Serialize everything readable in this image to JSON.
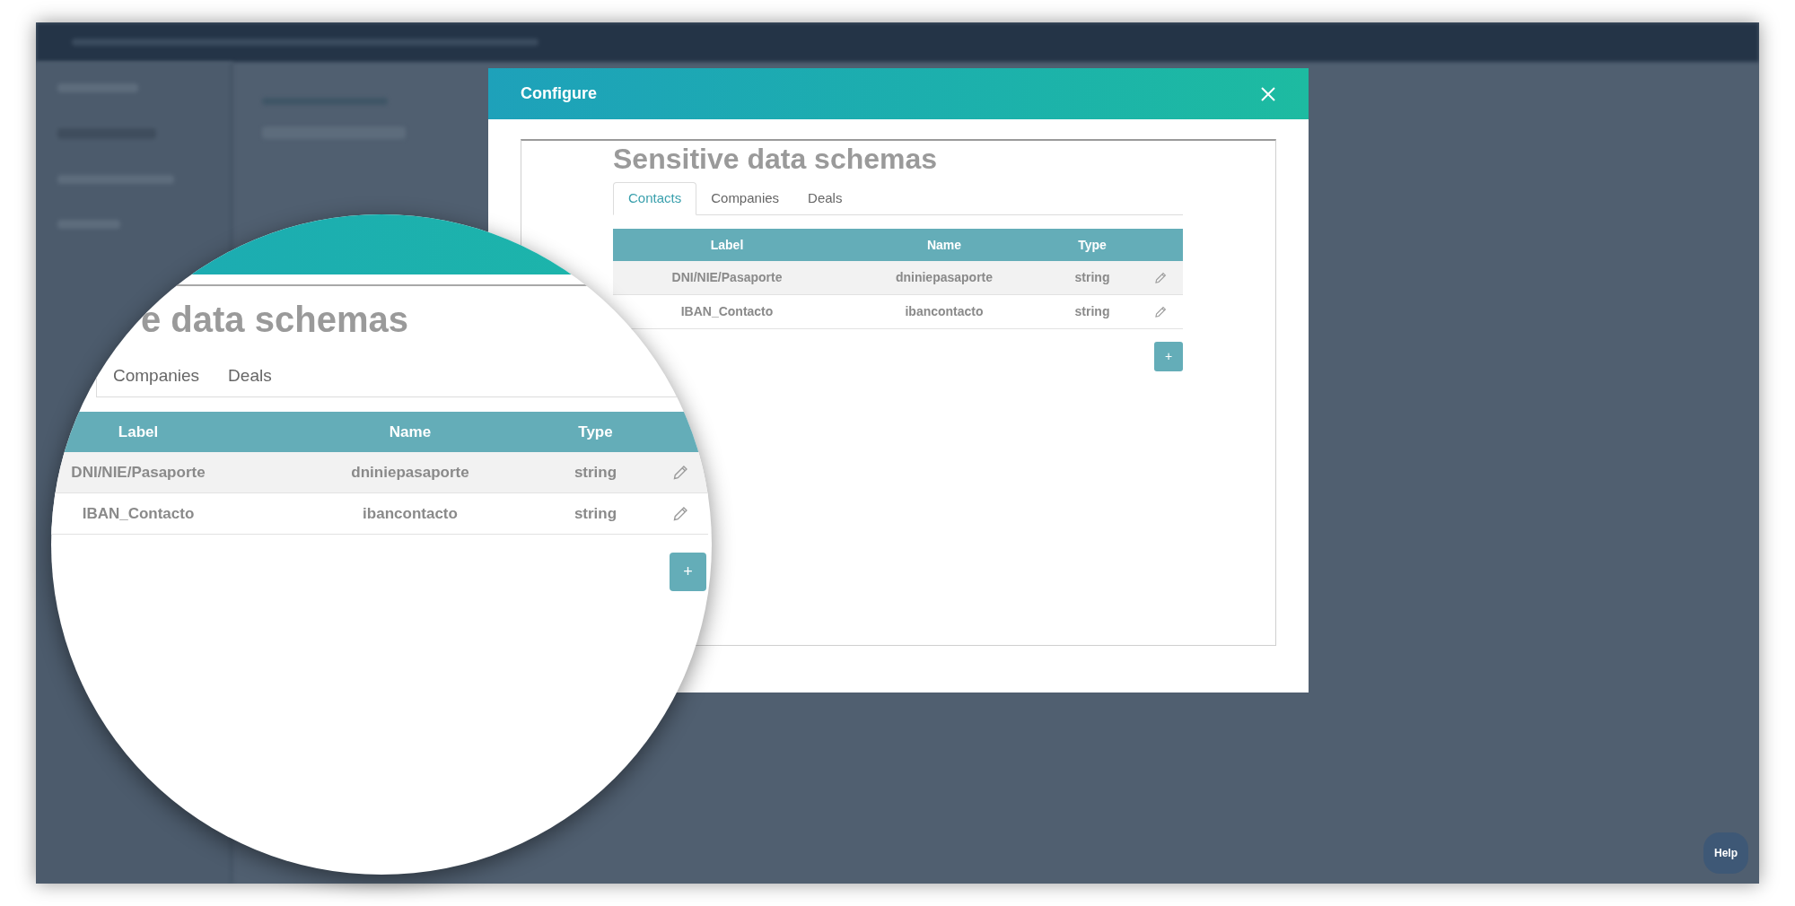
{
  "modal": {
    "title": "Configure",
    "heading": "Sensitive data schemas",
    "tabs": [
      {
        "label": "Contacts",
        "selected": true
      },
      {
        "label": "Companies",
        "selected": false
      },
      {
        "label": "Deals",
        "selected": false
      }
    ],
    "table": {
      "columns": [
        "Label",
        "Name",
        "Type"
      ],
      "rows": [
        {
          "cells": [
            "DNI/NIE/Pasaporte",
            "dniniepasaporte",
            "string"
          ],
          "highlighted": true
        },
        {
          "cells": [
            "IBAN_Contacto",
            "ibancontacto",
            "string"
          ],
          "highlighted": false
        }
      ]
    },
    "add_button": "+"
  },
  "magnifier": {
    "heading": "e data schemas",
    "tabs": [
      {
        "label": "Companies",
        "selected": false
      },
      {
        "label": "Deals",
        "selected": false
      }
    ],
    "table": {
      "columns": [
        "Label",
        "Name",
        "Type"
      ],
      "rows": [
        {
          "cells": [
            "DNI/NIE/Pasaporte",
            "dniniepasaporte",
            "string"
          ],
          "highlighted": true
        },
        {
          "cells": [
            "IBAN_Contacto",
            "ibancontacto",
            "string"
          ],
          "highlighted": false
        }
      ]
    },
    "add_button": "+"
  },
  "help_button": "Help"
}
